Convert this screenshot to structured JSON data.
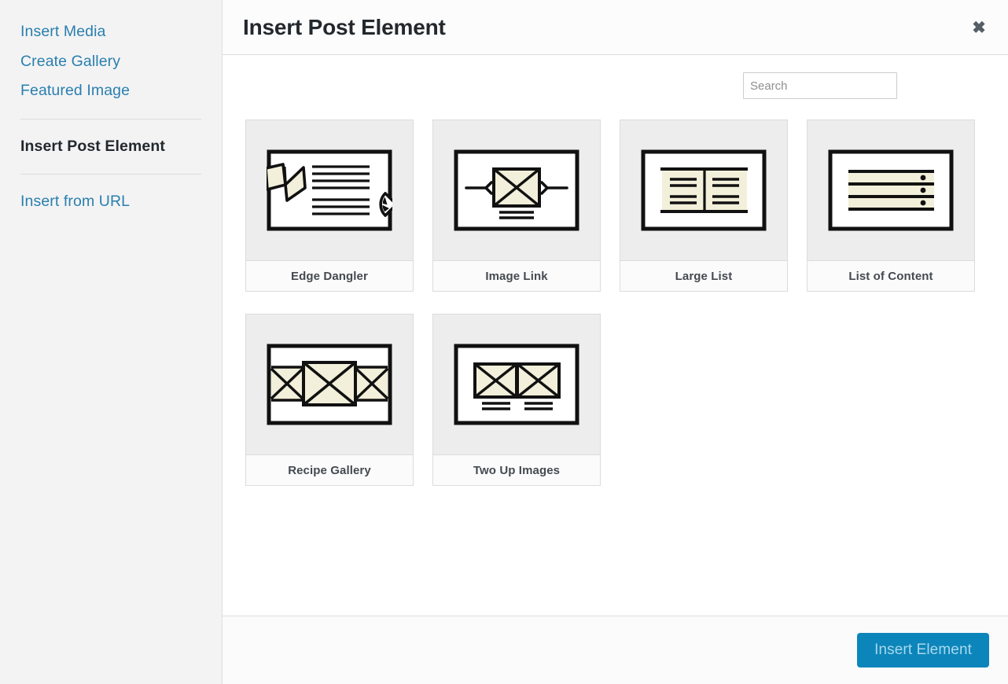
{
  "sidebar": {
    "items": [
      {
        "label": "Insert Media",
        "active": false,
        "name": "insert-media"
      },
      {
        "label": "Create Gallery",
        "active": false,
        "name": "create-gallery"
      },
      {
        "label": "Featured Image",
        "active": false,
        "name": "featured-image"
      },
      {
        "label": "Insert Post Element",
        "active": true,
        "name": "insert-post-element"
      },
      {
        "label": "Insert from URL",
        "active": false,
        "name": "insert-from-url"
      }
    ]
  },
  "header": {
    "title": "Insert Post Element",
    "close_label": "✖",
    "close_icon": "close-icon"
  },
  "search": {
    "value": "",
    "placeholder": "Search"
  },
  "elements": [
    {
      "label": "Edge Dangler",
      "icon": "edge-dangler-icon"
    },
    {
      "label": "Image Link",
      "icon": "image-link-icon"
    },
    {
      "label": "Large List",
      "icon": "large-list-icon"
    },
    {
      "label": "List of Content",
      "icon": "list-of-content-icon"
    },
    {
      "label": "Recipe Gallery",
      "icon": "recipe-gallery-icon"
    },
    {
      "label": "Two Up Images",
      "icon": "two-up-images-icon"
    }
  ],
  "footer": {
    "insert_label": "Insert Element"
  },
  "colors": {
    "link": "#2a7fad",
    "accent": "#0c85ba",
    "accent_text": "#a8d8ee",
    "sidebar_bg": "#f3f3f4",
    "card_bg": "#ededee",
    "thumb_fill": "#f2efda",
    "ink": "#111111"
  }
}
